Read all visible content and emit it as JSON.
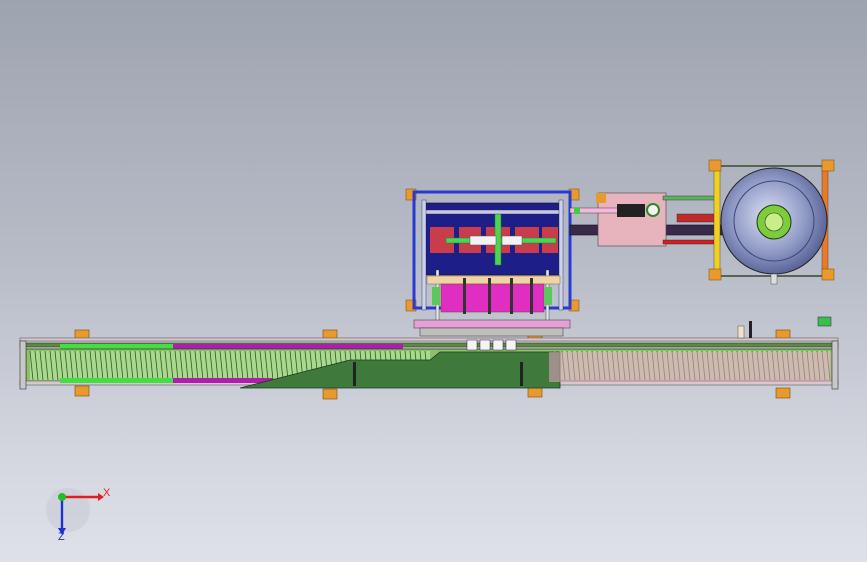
{
  "viewport": {
    "background_top": "#9ea3b0",
    "background_bottom": "#dfe1e8"
  },
  "triad": {
    "x_label": "X",
    "z_label": "Z",
    "x_color": "#e02020",
    "y_color": "#20c020",
    "z_color": "#2030d0"
  },
  "model": {
    "type": "cad-assembly-front-view",
    "components": [
      "conveyor-bed",
      "press-frame",
      "cylinder-rod",
      "tank-frame",
      "storage-tank",
      "bracket"
    ]
  }
}
